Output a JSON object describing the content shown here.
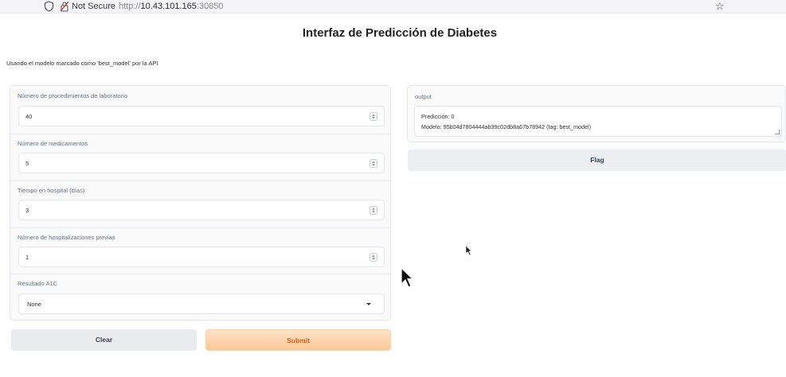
{
  "browser": {
    "security_label": "Not Secure",
    "url_scheme": "http://",
    "url_host": "10.43.101.165",
    "url_port": ":30850"
  },
  "page": {
    "title": "Interfaz de Predicción de Diabetes",
    "subtitle": "Usando el modelo marcado como 'best_model' por la API"
  },
  "inputs": {
    "lab_procedures": {
      "label": "Número de procedimientos de laboratorio",
      "value": "40"
    },
    "medications": {
      "label": "Número de medicamentos",
      "value": "5"
    },
    "hospital_days": {
      "label": "Tiempo en hospital (días)",
      "value": "3"
    },
    "prior_hospitalizations": {
      "label": "Número de hospitalizaciones previas",
      "value": "1"
    },
    "a1c_result": {
      "label": "Resultado A1C",
      "value": "None"
    }
  },
  "buttons": {
    "clear": "Clear",
    "submit": "Submit",
    "flag": "Flag"
  },
  "output": {
    "label": "output",
    "line1": "Predicción: 0",
    "line2": "Modelo: 95b04d7804444ab39c02db8a67b78942 (tag: best_model)"
  }
}
